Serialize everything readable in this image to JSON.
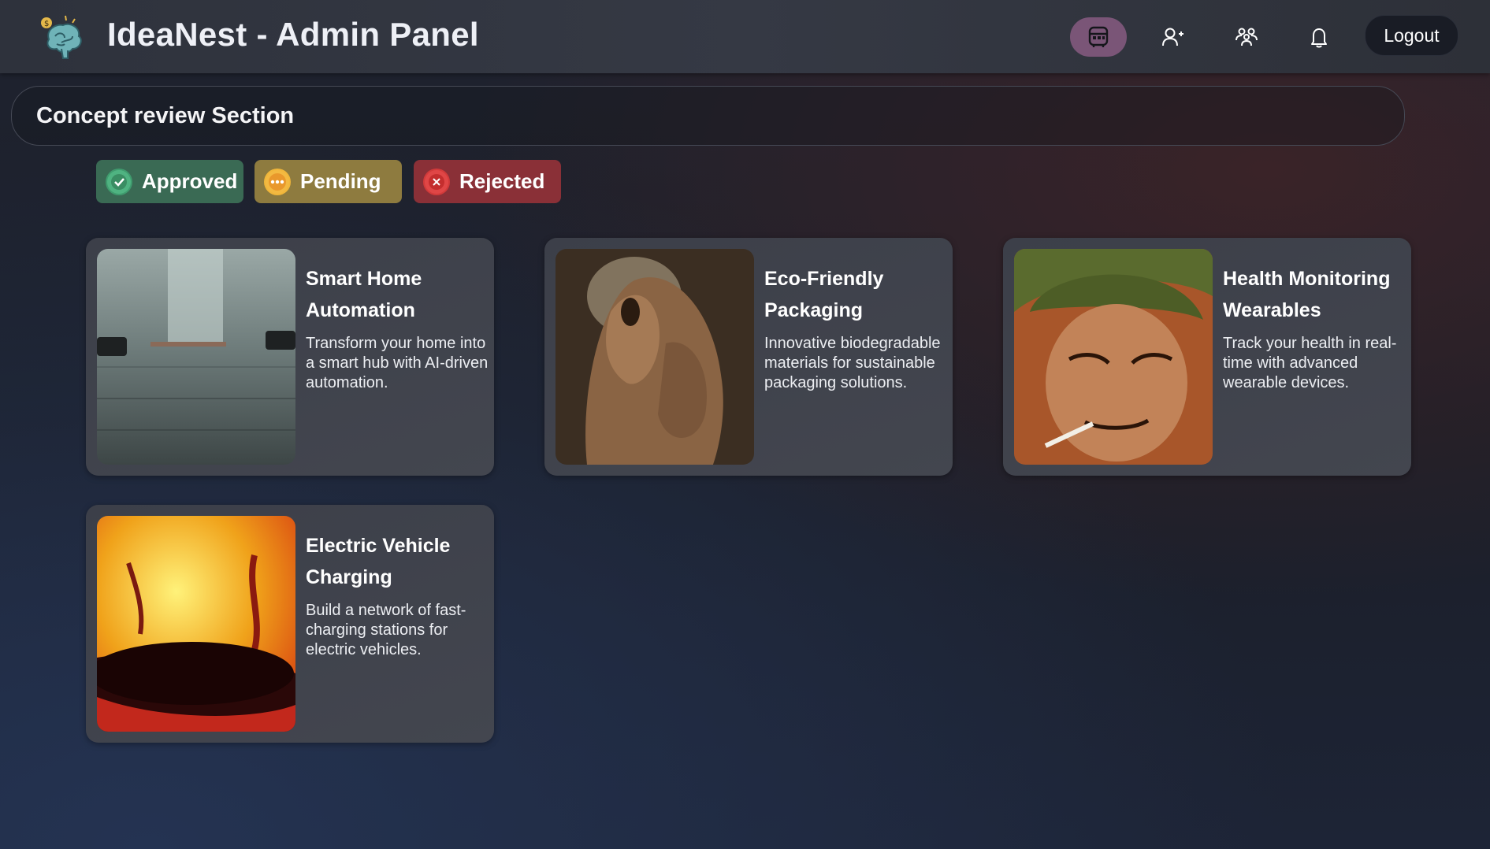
{
  "header": {
    "title": "IdeaNest - Admin Panel",
    "logo_icon": "brain-idea-logo",
    "nav": [
      {
        "icon": "dashboard-icon",
        "active": true
      },
      {
        "icon": "add-user-icon",
        "active": false
      },
      {
        "icon": "users-group-icon",
        "active": false
      },
      {
        "icon": "bell-icon",
        "active": false
      }
    ],
    "logout_label": "Logout"
  },
  "section": {
    "title": "Concept review Section"
  },
  "filters": {
    "approved": "Approved",
    "pending": "Pending",
    "rejected": "Rejected"
  },
  "cards": [
    {
      "title": "Smart Home Automation",
      "description": "Transform your home into a smart hub with AI-driven automation.",
      "image": "empty-garage-with-cars"
    },
    {
      "title": "Eco-Friendly Packaging",
      "description": "Innovative biodegradable materials for sustainable packaging solutions.",
      "image": "mud-monster-illustration"
    },
    {
      "title": "Health Monitoring Wearables",
      "description": "Track your health in real-time with advanced wearable devices.",
      "image": "soldier-with-cigarette-illustration"
    },
    {
      "title": "Electric Vehicle Charging",
      "description": "Build a network of fast-charging stations for electric vehicles.",
      "image": "fiery-abstract-illustration"
    }
  ],
  "colors": {
    "approved": "#3a6a54",
    "pending": "#8e7b3f",
    "rejected": "#8a3037",
    "active_nav": "#7a5577"
  }
}
